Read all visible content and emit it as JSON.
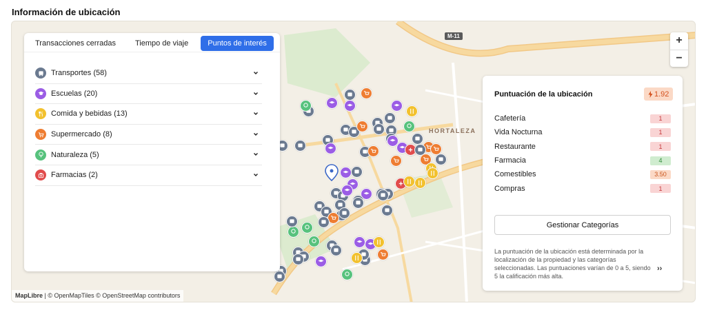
{
  "section_title": "Información de ubicación",
  "tabs": [
    {
      "label": "Transacciones cerradas",
      "active": false
    },
    {
      "label": "Tiempo de viaje",
      "active": false
    },
    {
      "label": "Puntos de interés",
      "active": true
    }
  ],
  "categories": [
    {
      "label": "Transportes (58)",
      "icon": "bus-icon",
      "color": "#6b7a90"
    },
    {
      "label": "Escuelas (20)",
      "icon": "graduation-cap-icon",
      "color": "#9b5de5"
    },
    {
      "label": "Comida y bebidas (13)",
      "icon": "cutlery-icon",
      "color": "#f2c12e"
    },
    {
      "label": "Supermercado (8)",
      "icon": "cart-icon",
      "color": "#ee7d32"
    },
    {
      "label": "Naturaleza (5)",
      "icon": "tree-icon",
      "color": "#57c27d"
    },
    {
      "label": "Farmacias (2)",
      "icon": "medkit-icon",
      "color": "#e14c4c"
    }
  ],
  "map": {
    "district": "HORTALEZA",
    "road_shield": "M-11",
    "zoom_in": "+",
    "zoom_out": "−",
    "attribution_brand": "MapLibre",
    "attribution_rest": " | © OpenMapTiles © OpenStreetMap contributors"
  },
  "score": {
    "title": "Puntuación de la ubicación",
    "value": "1.92",
    "rows": [
      {
        "name": "Cafetería",
        "value": "1",
        "tone": "red"
      },
      {
        "name": "Vida Nocturna",
        "value": "1",
        "tone": "red"
      },
      {
        "name": "Restaurante",
        "value": "1",
        "tone": "red"
      },
      {
        "name": "Farmacia",
        "value": "4",
        "tone": "green"
      },
      {
        "name": "Comestibles",
        "value": "3.50",
        "tone": "orange"
      },
      {
        "name": "Compras",
        "value": "1",
        "tone": "red"
      }
    ],
    "manage_label": "Gestionar Categorías",
    "note": "La puntuación de la ubicación está determinada por la localización de la propiedad y las categorías seleccionadas. Las puntuaciones varían de 0 a 5, siendo 5 la calificación más alta.",
    "more": "››"
  }
}
